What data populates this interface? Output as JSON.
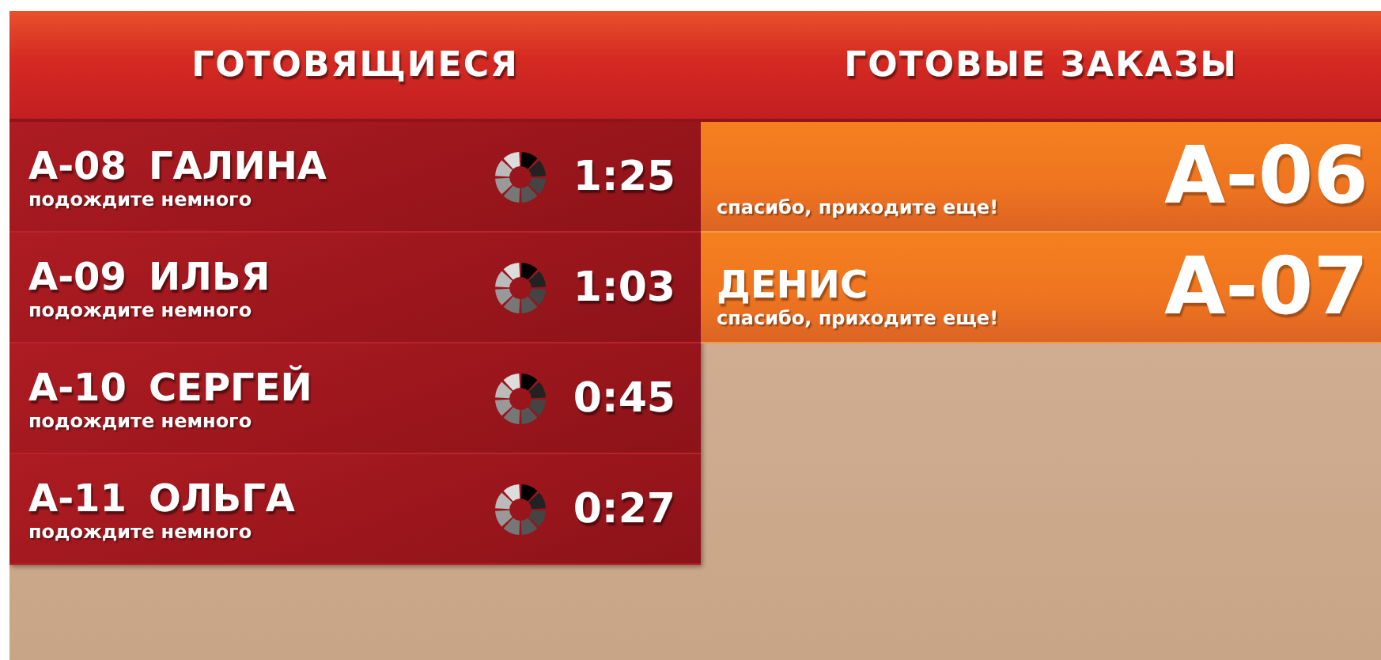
{
  "preparing": {
    "title": "ГОТОВЯЩИЕСЯ",
    "orders": [
      {
        "number": "А-08",
        "name": "ГАЛИНА",
        "note": "подождите немного",
        "time": "1:25"
      },
      {
        "number": "А-09",
        "name": "ИЛЬЯ",
        "note": "подождите немного",
        "time": "1:03"
      },
      {
        "number": "А-10",
        "name": "СЕРГЕЙ",
        "note": "подождите немного",
        "time": "0:45"
      },
      {
        "number": "А-11",
        "name": "ОЛЬГА",
        "note": "подождите немного",
        "time": "0:27"
      }
    ]
  },
  "ready": {
    "title": "ГОТОВЫЕ ЗАКАЗЫ",
    "orders": [
      {
        "number": "А-06",
        "note": "спасибо, приходите еще!"
      },
      {
        "name": "ДЕНИС",
        "number": "А-07",
        "note": "спасибо, приходите еще!"
      }
    ]
  }
}
